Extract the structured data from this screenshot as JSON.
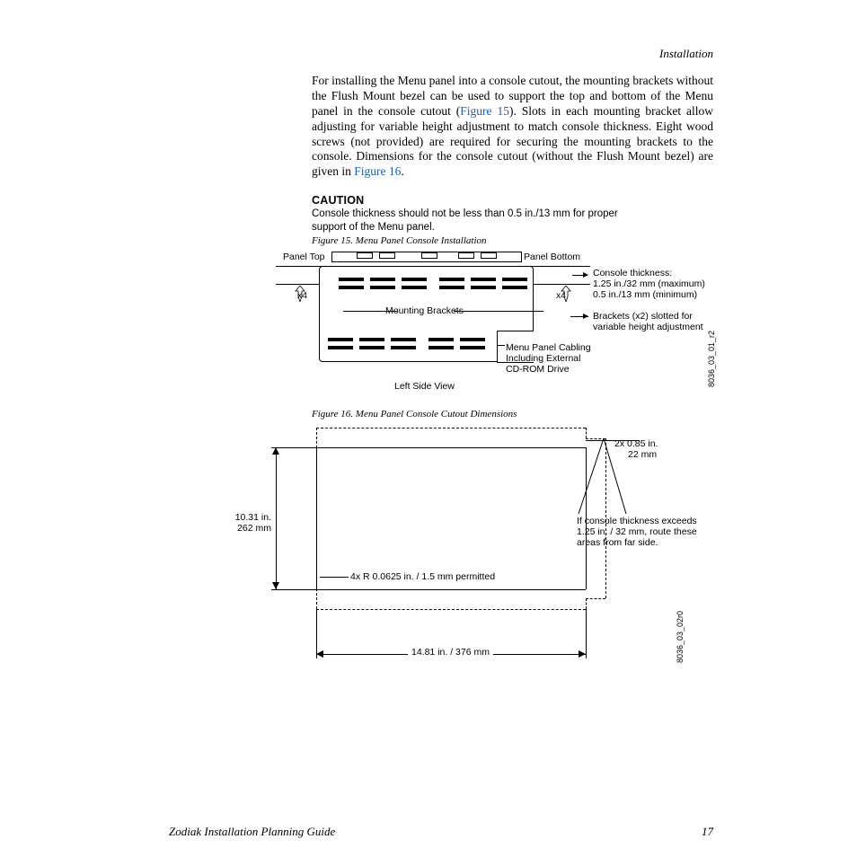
{
  "header": {
    "section": "Installation"
  },
  "body": {
    "p1a": "For installing the Menu panel into a console cutout, the mounting brackets without the Flush Mount bezel can be used to support the top and bottom of the Menu panel in the console cutout (",
    "link15": "Figure 15",
    "p1b": "). Slots in each mounting bracket allow adjusting for variable height adjustment to match console thickness. Eight wood screws (not provided) are required for securing the mounting brackets to the console. Dimensions for the console cutout (without the Flush Mount bezel) are given in ",
    "link16": "Figure 16",
    "p1c": "."
  },
  "caution": {
    "label": "CAUTION",
    "text": "Console thickness should not be less than 0.5 in./13 mm for proper support of the Menu panel."
  },
  "fig15": {
    "caption": "Figure 15.  Menu Panel Console Installation",
    "panelTop": "Panel Top",
    "panelBottom": "Panel Bottom",
    "x4": "x4",
    "mountingBrackets": "Mounting Brackets",
    "consoleThickness1": "Console thickness:",
    "consoleThickness2": "1.25 in./32 mm (maximum)",
    "consoleThickness3": "0.5 in./13 mm (minimum)",
    "brackets1": "Brackets (x2) slotted for",
    "brackets2": "variable height adjustment",
    "cabling1": "Menu Panel Cabling",
    "cabling2": "Including External",
    "cabling3": "CD-ROM Drive",
    "leftSideView": "Left Side View",
    "drawingNo": "8036_03_01_r2"
  },
  "fig16": {
    "caption": "Figure 16.  Menu Panel Console Cutout Dimensions",
    "cutNote1": "2x  0.85 in.",
    "cutNote2": "22 mm",
    "height1": "10.31 in.",
    "height2": "262 mm",
    "thickNote1": "If console thickness exceeds",
    "thickNote2": "1.25 in. / 32 mm, route these",
    "thickNote3": "areas from far side.",
    "radius": "4x R 0.0625 in. / 1.5 mm permitted",
    "width": "14.81 in. / 376 mm",
    "drawingNo": "8036_03_02r0"
  },
  "footer": {
    "title": "Zodiak Installation Planning Guide",
    "page": "17"
  }
}
